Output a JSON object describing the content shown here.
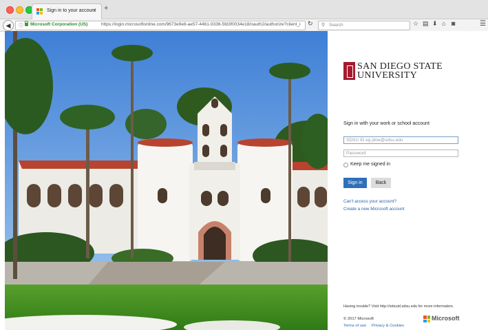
{
  "browser": {
    "tab_title": "Sign in to your account",
    "tab_close": "×",
    "new_tab": "+",
    "identity": "Microsoft Corporation (US)",
    "url": "https://login.microsoftonline.com/9673e9e8-ae57-4461-9336-5fd3f0034e18/oauth2/authorize?client_id=00000003-",
    "search_placeholder": "Search"
  },
  "signin": {
    "org_name_line1": "SAN DIEGO STATE",
    "org_name_line2": "UNIVERSITY",
    "heading": "Sign in with your work or school account",
    "username_placeholder": "SDSU ID eg jdoe@sdsu.edu",
    "password_placeholder": "Password",
    "keep_signed_in": "Keep me signed in",
    "signin_button": "Sign in",
    "back_button": "Back",
    "cant_access": "Can't access your account?",
    "create_account": "Create a new Microsoft account"
  },
  "footer": {
    "trouble": "Having trouble? Visit http://sdsuid.sdsu.edu for more information.",
    "copyright": "© 2017 Microsoft",
    "terms": "Terms of use",
    "privacy": "Privacy & Cookies",
    "brand": "Microsoft"
  },
  "colors": {
    "sdsu_red": "#a6192e",
    "signin_blue": "#2f6fb8",
    "link_blue": "#2a62ae"
  }
}
